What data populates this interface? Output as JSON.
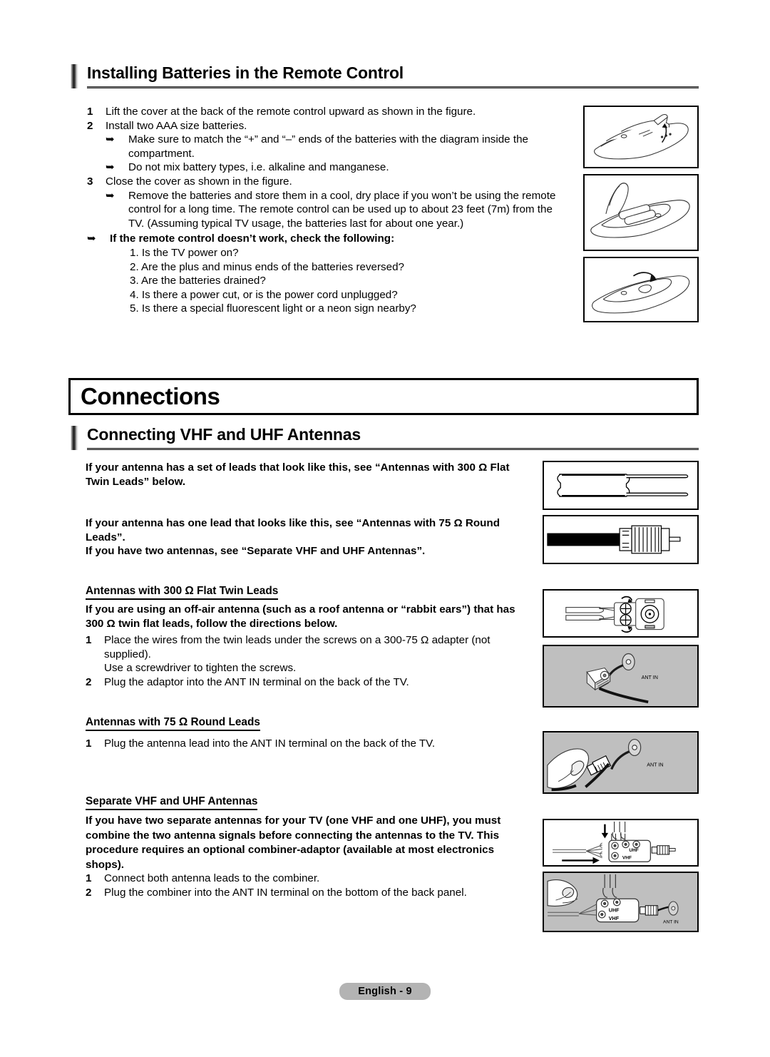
{
  "page": {
    "footer_label": "English - 9"
  },
  "section1": {
    "heading": "Installing Batteries in the Remote Control",
    "steps": [
      {
        "num": "1",
        "text": "Lift the cover at the back of the remote control upward as shown in the figure."
      },
      {
        "num": "2",
        "text": "Install two AAA size batteries."
      }
    ],
    "bullets_after_2": [
      "Make sure to match the “+” and “–” ends of the batteries with the diagram inside the compartment.",
      "Do not mix battery types, i.e. alkaline and manganese."
    ],
    "step3": {
      "num": "3",
      "text": "Close the cover as shown in the figure."
    },
    "bullet_after_3": "Remove the batteries and store them in a cool, dry place if you won’t be using the remote control for a long time. The remote control can be used up to about 23 feet (7m) from the TV. (Assuming typical TV usage, the batteries last for about one year.)",
    "troubleshoot_title": "If the remote control doesn’t work, check the following:",
    "troubleshoot_items": [
      "1. Is the TV power on?",
      "2. Are the plus and minus ends of the batteries reversed?",
      "3. Are the batteries drained?",
      "4. Is there a power cut, or is the power cord unplugged?",
      "5. Is there a special fluorescent light or a neon sign nearby?"
    ],
    "figures": [
      {
        "name": "remote-cover-lift-figure",
        "caption_alt": "Lifting the battery cover at the back of the remote control"
      },
      {
        "name": "remote-batteries-insert-figure",
        "caption_alt": "Remote control with cover open showing two AAA batteries"
      },
      {
        "name": "remote-cover-close-figure",
        "caption_alt": "Closing the battery cover on the remote control"
      }
    ]
  },
  "chapter": {
    "title": "Connections"
  },
  "section2": {
    "heading": "Connecting VHF and UHF Antennas",
    "intro_300": "If your antenna has a set of leads that look like this, see “Antennas with 300 Ω Flat Twin Leads” below.",
    "intro_75": "If your antenna has one lead that looks like this, see “Antennas with 75 Ω Round Leads”.",
    "intro_two": "If you have two antennas, see “Separate VHF and UHF Antennas”.",
    "sub1": {
      "title": "Antennas with 300 Ω Flat Twin Leads",
      "lead": "If you are using an off-air antenna (such as a roof antenna or “rabbit ears”) that has 300 Ω twin flat leads, follow the directions below.",
      "steps": [
        {
          "num": "1",
          "text": "Place the wires from the twin leads under the screws on a 300-75 Ω adapter (not supplied)."
        },
        {
          "num": "",
          "text": "Use a screwdriver to tighten the screws."
        },
        {
          "num": "2",
          "text": "Plug the adaptor into the ANT IN terminal on the back of the TV."
        }
      ]
    },
    "sub2": {
      "title": "Antennas with 75 Ω Round Leads",
      "steps": [
        {
          "num": "1",
          "text": "Plug the antenna lead into the ANT IN terminal on the back of the TV."
        }
      ]
    },
    "sub3": {
      "title": "Separate VHF and UHF Antennas",
      "lead": "If you have two separate antennas for your TV (one VHF and one UHF), you must combine the two antenna signals before connecting the antennas to the TV. This procedure requires an optional combiner-adaptor (available at most electronics shops).",
      "steps": [
        {
          "num": "1",
          "text": "Connect both antenna leads to the combiner."
        },
        {
          "num": "2",
          "text": "Plug the combiner into the ANT IN terminal on the bottom of the back panel."
        }
      ]
    },
    "figure_labels": {
      "ant_in": "ANT IN",
      "uhf": "UHF",
      "vhf": "VHF"
    },
    "figures": [
      {
        "name": "flat-twin-lead-figure"
      },
      {
        "name": "round-coax-lead-figure"
      },
      {
        "name": "adapter-screws-figure"
      },
      {
        "name": "adapter-into-antin-figure"
      },
      {
        "name": "coax-into-antin-figure"
      },
      {
        "name": "combiner-leads-figure"
      },
      {
        "name": "combiner-into-antin-figure"
      }
    ]
  }
}
